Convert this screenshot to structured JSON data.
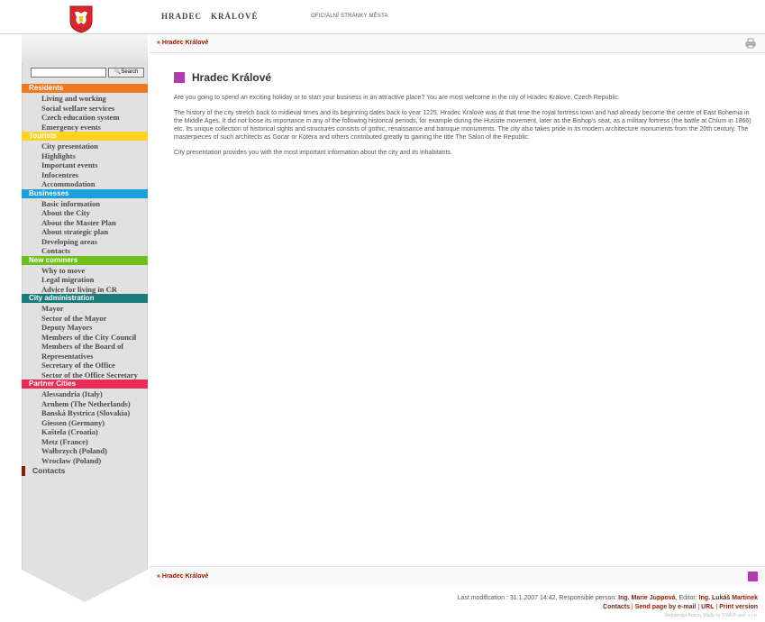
{
  "header": {
    "city_word1": "HRADEC",
    "city_word2": "KRÁLOVÉ",
    "official": "OFICIÁLNÍ STRÁNKY MĚSTA"
  },
  "search": {
    "button": "Search",
    "value": ""
  },
  "colors": {
    "residents": "#f07820",
    "tourists": "#ffd21f",
    "businesses": "#1aa0dc",
    "new_commers": "#6cbf1c",
    "city_admin": "#1a7c78",
    "partner": "#ec2c56",
    "accent": "#b33bb0",
    "link": "#8b1a00"
  },
  "menu": {
    "residents": {
      "label": "Residents",
      "items": [
        "Living and working",
        "Social welfare services",
        "Czech education system",
        "Emergency events"
      ]
    },
    "tourists": {
      "label": "Tourists",
      "items": [
        "City presentation",
        "Highlights",
        "Important events",
        "Infocentres",
        "Accommodation"
      ]
    },
    "businesses": {
      "label": "Businesses",
      "items": [
        "Basic information",
        "About the City",
        "About the Master Plan",
        "About strategic plan",
        "Developing areas",
        "Contacts"
      ]
    },
    "new_commers": {
      "label": "New commers",
      "items": [
        "Why to move",
        "Legal migration",
        "Advice for living in CR"
      ]
    },
    "city_admin": {
      "label": "City administration",
      "items": [
        "Mayor",
        "Sector of the Mayor",
        "Deputy Mayors",
        "Members of the City Council",
        "Members of the Board of Representatives",
        "Secretary of the Office",
        "Sector of the Office Secretary"
      ]
    },
    "partner": {
      "label": "Partner Cities",
      "items": [
        "Alessandria (Italy)",
        "Arnhem (The Netherlands)",
        "Banská Bystrica (Slovakia)",
        "Giessen (Germany)",
        "Kaštela (Croatia)",
        "Metz (France)",
        "Wałbrzych (Poland)",
        "Wrocław (Poland)"
      ]
    },
    "contacts": "Contacts"
  },
  "breadcrumb": "Hradec Králové",
  "page": {
    "title": "Hradec Králové",
    "p1": "Are you going to spend an exciting holiday or to start your business in an attractive place? You are most welcome in the city of Hradec Kralove, Czech Republic.",
    "p2": "The history of the city stretch back to midieval times and its beginning dates back to year 1225. Hradec Kralove was at that time the royal fortress town and had already become the centre of East Bohemia in the Middle Ages. It did not loose its importance in any of the following historical periods, for example during the Hussite movement, later as the Bishop's seat, as a military fortress (the battle at Chlum in 1866) etc. Its unique collection of historical sights and structures consists of gothic, renaissance and baroque monuments. The city also takes pride in its modern architecture monuments from the 20th century. The masterpieces of such architects as Gocar or Kotera and others contributed greatly to gaining the title The Salon of the Republic.",
    "p3": "City presentation provides you with the most important information about the city and its inhabitants."
  },
  "footer": {
    "modified": "Last modification : 31.1.2007 14:42, Responsible person:",
    "person": "Ing. Marie Juppová",
    "editor_label": ", Editor:",
    "editor": "Ing. Lukáš Martinek",
    "link_contacts": "Contacts",
    "link_send": "Send page by e-mail",
    "link_url": "URL",
    "link_print": "Print version",
    "credit": "Webdesign Anson. Made by T-WEB spol. s r.o."
  }
}
